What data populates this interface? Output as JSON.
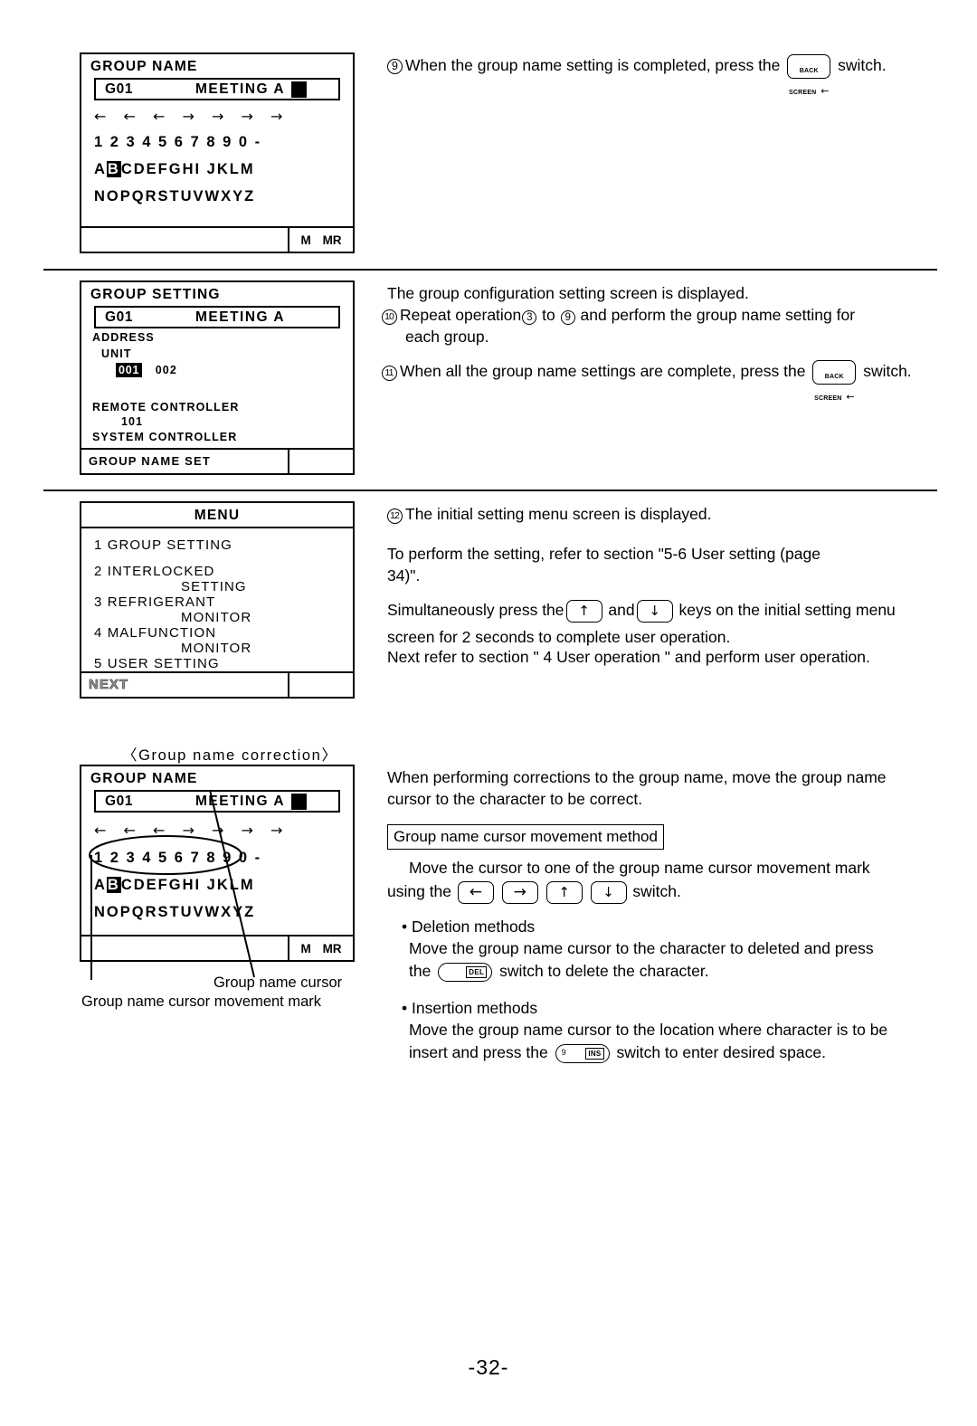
{
  "page": {
    "number": "-32-"
  },
  "panel1": {
    "title": "GROUP NAME",
    "group_id": "G01",
    "group_name": "MEETING A",
    "arrows": "← ← ← → → → →",
    "char_row_1": "1 2 3 4 5 6 7 8 9 0 -",
    "char_row_2_pre": "A",
    "char_row_2_hl": "B",
    "char_row_2_post": "CDEFGHI JKLM",
    "char_row_3": "NOPQRSTUVWXYZ",
    "footer_left": "",
    "footer_m": "M",
    "footer_mr": "MR"
  },
  "step9": {
    "num": "9",
    "text_before": "When the group name setting is completed, press the",
    "key": {
      "line1": "BACK",
      "line2": "SCREEN",
      "arrow": "←"
    },
    "text_after": "switch."
  },
  "panel2": {
    "title": "GROUP SETTING",
    "group_id": "G01",
    "group_name": "MEETING A",
    "address_label": "ADDRESS",
    "unit_label": "UNIT",
    "unit_selected": "001",
    "unit_other": "002",
    "remote_controller_label": "REMOTE CONTROLLER",
    "remote_controller_value": "101",
    "system_controller_label": "SYSTEM CONTROLLER",
    "footer_left": "GROUP NAME SET"
  },
  "block2": {
    "line1": "The group configuration setting screen is displayed.",
    "step10_num": "10",
    "step10_a": "Repeat operation",
    "step10_ref1": "3",
    "step10_b": "to",
    "step10_ref2": "9",
    "step10_c": "and perform the group name setting for",
    "step10_d": "each group.",
    "step11_num": "11",
    "step11_a": "When all the group name settings are complete, press the",
    "step11_key": {
      "line1": "BACK",
      "line2": "SCREEN",
      "arrow": "←"
    },
    "step11_b": "switch."
  },
  "panel3": {
    "title": "MENU",
    "items": [
      {
        "label": "1 GROUP SETTING",
        "sub": ""
      },
      {
        "label": "2 INTERLOCKED",
        "sub": "SETTING"
      },
      {
        "label": "3 REFRIGERANT",
        "sub": "MONITOR"
      },
      {
        "label": "4 MALFUNCTION",
        "sub": "MONITOR"
      },
      {
        "label": "5 USER SETTING",
        "sub": ""
      }
    ],
    "footer_left": "NEXT"
  },
  "block3": {
    "step12_num": "12",
    "step12_text": "The initial setting menu screen is displayed.",
    "para1_l1": "To perform the setting, refer to section \"5-6 User setting (page",
    "para1_l2": "34)\".",
    "para2_a": "Simultaneously press the",
    "key_up": "↑",
    "para2_b": "and",
    "key_down": "↓",
    "para2_c": "keys on the initial setting menu",
    "para2_l2": "screen for 2 seconds to complete user operation.",
    "para2_l3": "Next refer to section \" 4 User operation \" and perform user operation."
  },
  "correction": {
    "title": "〈Group name correction〉",
    "panel": {
      "title": "GROUP NAME",
      "group_id": "G01",
      "group_name": "MEETING A",
      "arrows": "← ← ← → → → →",
      "char_row_1": "1 2 3 4 5 6 7 8 9 0 -",
      "char_row_2_pre": "A",
      "char_row_2_hl": "B",
      "char_row_2_post": "CDEFGHI JKLM",
      "char_row_3": "NOPQRSTUVWXYZ",
      "footer_m": "M",
      "footer_mr": "MR"
    },
    "callout_cursor": "Group name cursor",
    "callout_mark": "Group name cursor movement mark"
  },
  "block4": {
    "intro_l1": "When performing corrections to the group name, move the group name",
    "intro_l2": "cursor to the character to be correct.",
    "boxed_head": "Group name cursor movement method",
    "move_l1": "Move the cursor to one of the group name cursor movement mark",
    "move_l2_a": "using the",
    "key_left": "←",
    "key_right": "→",
    "key_up": "↑",
    "key_down": "↓",
    "move_l2_b": "switch.",
    "del_head": "• Deletion methods",
    "del_l1": "Move the group name cursor to the character to deleted and press",
    "del_l2_a": "the",
    "del_key_tag": "DEL",
    "del_l2_b": "switch to delete the character.",
    "ins_head": "• Insertion methods",
    "ins_l1": "Move the group name cursor to the location where character is to be",
    "ins_l2_a": "insert and press the",
    "ins_key_num": "9",
    "ins_key_tag": "INS",
    "ins_l2_b": "switch to enter desired space."
  }
}
